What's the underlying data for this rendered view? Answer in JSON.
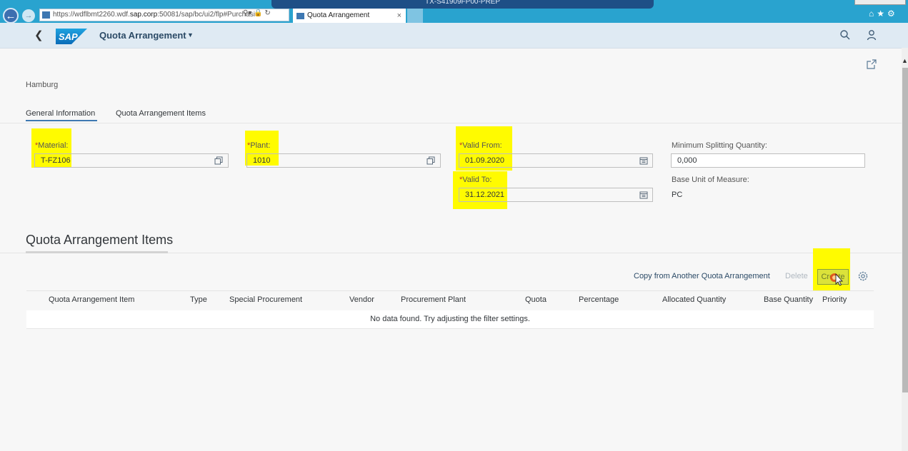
{
  "browser": {
    "vpn_title": "TX-S41909FP00-PREP",
    "url_prefix": "https://wdflbmt2260.wdf.",
    "url_domain": "sap.corp",
    "url_suffix": ":50081/sap/bc/ui2/flp#Purchasi",
    "tab_title": "Quota Arrangement",
    "tab_close": "×"
  },
  "shell": {
    "app_title": "Quota Arrangement",
    "logo_text": "SAP"
  },
  "header": {
    "subtitle": "Hamburg",
    "tabs": [
      {
        "label": "General Information"
      },
      {
        "label": "Quota Arrangement Items"
      }
    ]
  },
  "form": {
    "material": {
      "label": "Material:",
      "value": "T-FZ106"
    },
    "plant": {
      "label": "Plant:",
      "value": "1010"
    },
    "valid_from": {
      "label": "Valid From:",
      "value": "01.09.2020"
    },
    "valid_to": {
      "label": "Valid To:",
      "value": "31.12.2021"
    },
    "min_split_qty": {
      "label": "Minimum Splitting Quantity:",
      "value": "0,000"
    },
    "base_uom": {
      "label": "Base Unit of Measure:",
      "value": "PC"
    }
  },
  "items_section": {
    "title": "Quota Arrangement Items",
    "toolbar": {
      "copy_label": "Copy from Another Quota Arrangement",
      "delete_label": "Delete",
      "create_label": "Create"
    },
    "columns": [
      "Quota Arrangement Item",
      "Type",
      "Special Procurement",
      "Vendor",
      "Procurement Plant",
      "Quota",
      "Percentage",
      "Allocated Quantity",
      "Base Quantity",
      "Priority"
    ],
    "empty_text": "No data found. Try adjusting the filter settings."
  },
  "colors": {
    "highlight": "#fffb00",
    "accent": "#3e78b2",
    "browser_bar": "#29a3cf"
  }
}
